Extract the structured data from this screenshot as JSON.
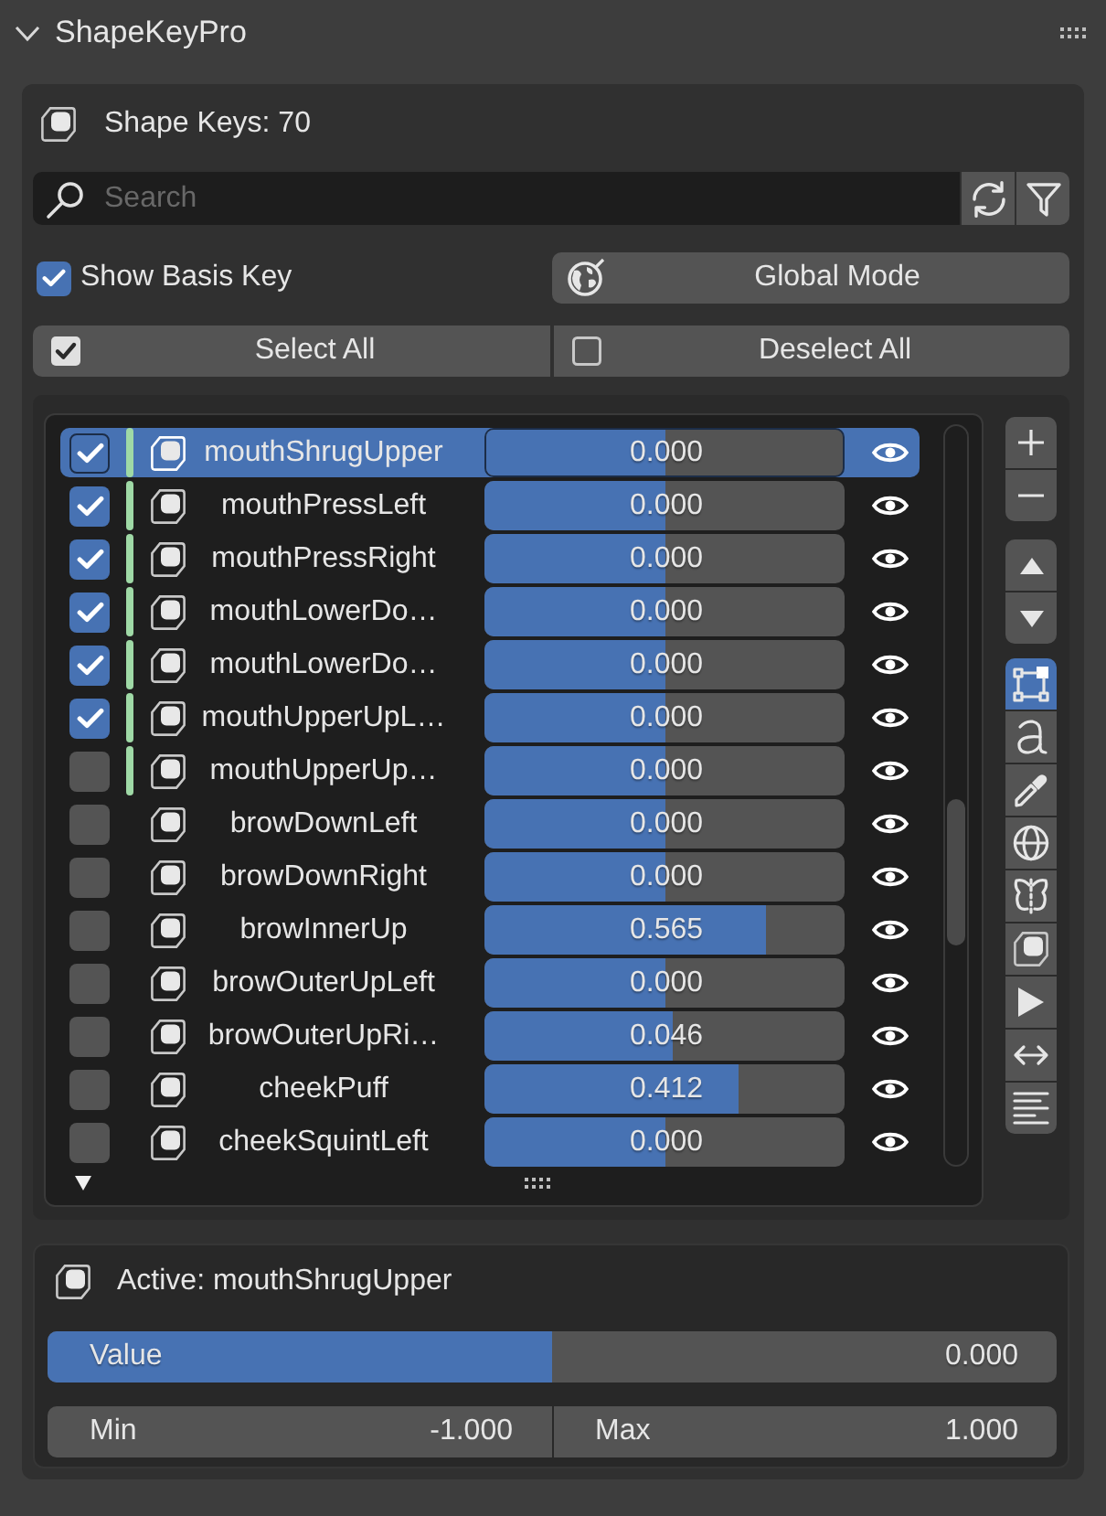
{
  "panel": {
    "title": "ShapeKeyPro",
    "expanded": true
  },
  "summary": {
    "label": "Shape Keys: 70"
  },
  "search": {
    "placeholder": "Search"
  },
  "show_basis_key": {
    "label": "Show Basis Key",
    "checked": true
  },
  "global_mode": {
    "label": "Global Mode"
  },
  "select_buttons": [
    {
      "kind": "select",
      "label": "Select All"
    },
    {
      "kind": "deselect",
      "label": "Deselect All"
    }
  ],
  "shape_keys": [
    {
      "name": "mouthShrugUpper",
      "selected": true,
      "checked": true,
      "marked": true,
      "value": "0.000",
      "level": 0.5,
      "visible": true
    },
    {
      "name": "mouthPressLeft",
      "selected": false,
      "checked": true,
      "marked": true,
      "value": "0.000",
      "level": 0.5,
      "visible": true
    },
    {
      "name": "mouthPressRight",
      "selected": false,
      "checked": true,
      "marked": true,
      "value": "0.000",
      "level": 0.5,
      "visible": true
    },
    {
      "name": "mouthLowerDo…",
      "selected": false,
      "checked": true,
      "marked": true,
      "value": "0.000",
      "level": 0.5,
      "visible": true
    },
    {
      "name": "mouthLowerDo…",
      "selected": false,
      "checked": true,
      "marked": true,
      "value": "0.000",
      "level": 0.5,
      "visible": true
    },
    {
      "name": "mouthUpperUpL…",
      "selected": false,
      "checked": true,
      "marked": true,
      "value": "0.000",
      "level": 0.5,
      "visible": true
    },
    {
      "name": "mouthUpperUp…",
      "selected": false,
      "checked": false,
      "marked": true,
      "value": "0.000",
      "level": 0.5,
      "visible": true
    },
    {
      "name": "browDownLeft",
      "selected": false,
      "checked": false,
      "marked": false,
      "value": "0.000",
      "level": 0.5,
      "visible": true
    },
    {
      "name": "browDownRight",
      "selected": false,
      "checked": false,
      "marked": false,
      "value": "0.000",
      "level": 0.5,
      "visible": true
    },
    {
      "name": "browInnerUp",
      "selected": false,
      "checked": false,
      "marked": false,
      "value": "0.565",
      "level": 0.7825,
      "visible": true
    },
    {
      "name": "browOuterUpLeft",
      "selected": false,
      "checked": false,
      "marked": false,
      "value": "0.000",
      "level": 0.5,
      "visible": true
    },
    {
      "name": "browOuterUpRi…",
      "selected": false,
      "checked": false,
      "marked": false,
      "value": "0.046",
      "level": 0.523,
      "visible": true
    },
    {
      "name": "cheekPuff",
      "selected": false,
      "checked": false,
      "marked": false,
      "value": "0.412",
      "level": 0.706,
      "visible": true
    },
    {
      "name": "cheekSquintLeft",
      "selected": false,
      "checked": false,
      "marked": false,
      "value": "0.000",
      "level": 0.5,
      "visible": true
    }
  ],
  "tools": [
    {
      "selected": true
    },
    {
      "selected": false
    },
    {
      "selected": false
    },
    {
      "selected": false
    },
    {
      "selected": false
    },
    {
      "selected": false
    },
    {
      "selected": false
    },
    {
      "selected": false
    },
    {
      "selected": false
    }
  ],
  "active": {
    "label": "Active: mouthShrugUpper",
    "value_label": "Value",
    "value": "0.000",
    "level": 0.5,
    "min_label": "Min",
    "min": "-1.000",
    "max_label": "Max",
    "max": "1.000"
  }
}
